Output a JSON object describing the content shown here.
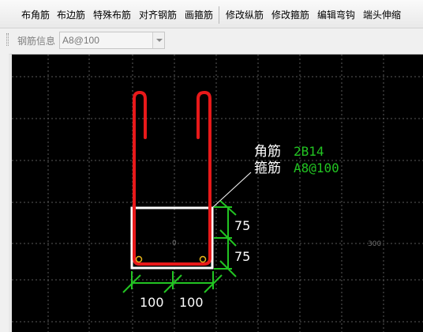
{
  "toolbar": {
    "items": [
      {
        "label": "布角筋"
      },
      {
        "label": "布边筋"
      },
      {
        "label": "特殊布筋"
      },
      {
        "label": "对齐钢筋"
      },
      {
        "label": "画箍筋"
      },
      {
        "label": "修改纵筋"
      },
      {
        "label": "修改箍筋"
      },
      {
        "label": "编辑弯钩"
      },
      {
        "label": "端头伸缩"
      }
    ]
  },
  "infobar": {
    "label": "钢筋信息",
    "value": "A8@100"
  },
  "drawing": {
    "annotation": {
      "corner_label": "角筋",
      "corner_value": "2B14",
      "stirrup_label": "箍筋",
      "stirrup_value": "A8@100"
    },
    "dims": {
      "vertical": [
        "75",
        "75"
      ],
      "horizontal": [
        "100",
        "100"
      ]
    },
    "axis_labels": {
      "origin": "0",
      "x_mark": "300"
    },
    "colors": {
      "background": "#000000",
      "grid": "#5a5a5a",
      "rebar": "#e8191a",
      "section": "#ffffff",
      "dimension": "#22c422",
      "annotation_value": "#22c422",
      "annotation_label": "#ffffff"
    }
  }
}
